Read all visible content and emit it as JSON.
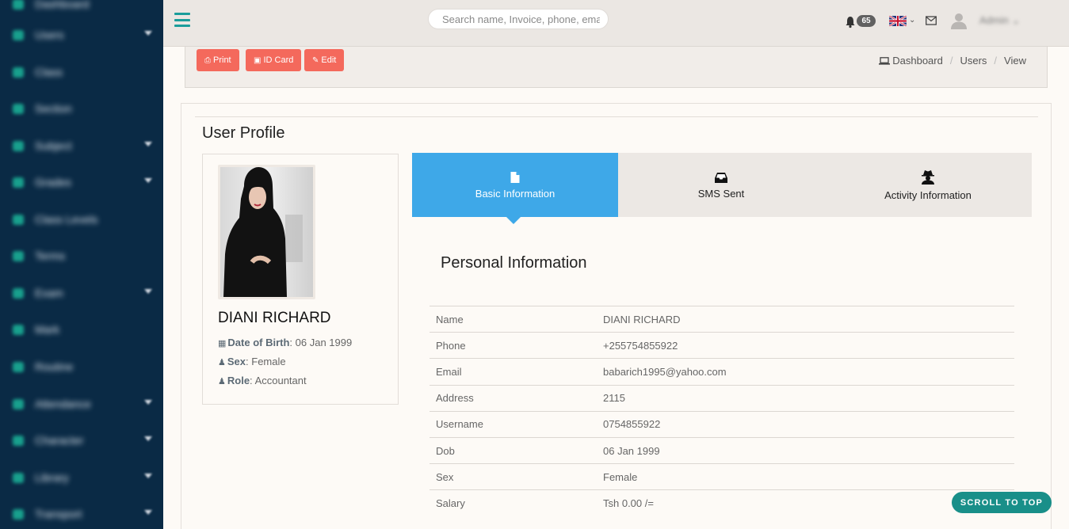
{
  "sidebar": {
    "items": [
      {
        "label": "Dashboard",
        "icon": "dashboard-icon",
        "caret": false
      },
      {
        "label": "Users",
        "icon": "users-icon",
        "caret": true
      },
      {
        "label": "Class",
        "icon": "class-icon",
        "caret": false
      },
      {
        "label": "Section",
        "icon": "section-icon",
        "caret": false
      },
      {
        "label": "Subject",
        "icon": "subject-icon",
        "caret": true
      },
      {
        "label": "Grades",
        "icon": "grades-icon",
        "caret": true
      },
      {
        "label": "Class Levels",
        "icon": "class-levels-icon",
        "caret": false
      },
      {
        "label": "Terms",
        "icon": "terms-icon",
        "caret": false
      },
      {
        "label": "Exam",
        "icon": "exam-icon",
        "caret": true
      },
      {
        "label": "Mark",
        "icon": "mark-icon",
        "caret": false
      },
      {
        "label": "Routine",
        "icon": "routine-icon",
        "caret": false
      },
      {
        "label": "Attendance",
        "icon": "attendance-icon",
        "caret": true
      },
      {
        "label": "Character",
        "icon": "character-icon",
        "caret": true
      },
      {
        "label": "Library",
        "icon": "library-icon",
        "caret": true
      },
      {
        "label": "Transport",
        "icon": "transport-icon",
        "caret": true
      }
    ]
  },
  "topbar": {
    "search_placeholder": "Search name, Invoice, phone, email",
    "notification_count": "65",
    "language_flag": "uk-flag-icon",
    "user_label": "Admin"
  },
  "actions": {
    "print_label": "Print",
    "idcard_label": "ID Card",
    "edit_label": "Edit"
  },
  "breadcrumb": {
    "dashboard": "Dashboard",
    "users": "Users",
    "view": "View"
  },
  "profile": {
    "page_title": "User Profile",
    "name": "DIANI RICHARD",
    "dob_label": "Date of Birth",
    "dob": "06 Jan 1999",
    "sex_label": "Sex",
    "sex": "Female",
    "role_label": "Role",
    "role": "Accountant"
  },
  "tabs": [
    {
      "label": "Basic Information",
      "icon": "file-icon",
      "active": true
    },
    {
      "label": "SMS Sent",
      "icon": "inbox-icon",
      "active": false
    },
    {
      "label": "Activity Information",
      "icon": "user-secret-icon",
      "active": false
    }
  ],
  "personal": {
    "title": "Personal Information",
    "rows": [
      {
        "key": "Name",
        "value": "DIANI RICHARD"
      },
      {
        "key": "Phone",
        "value": "+255754855922"
      },
      {
        "key": "Email",
        "value": "babarich1995@yahoo.com"
      },
      {
        "key": "Address",
        "value": "2115"
      },
      {
        "key": "Username",
        "value": "0754855922"
      },
      {
        "key": "Dob",
        "value": "06 Jan 1999"
      },
      {
        "key": "Sex",
        "value": "Female"
      },
      {
        "key": "Salary",
        "value": "Tsh 0.00 /="
      }
    ]
  },
  "scroll_top_label": "SCROLL TO TOP",
  "colors": {
    "sidebar_bg": "#0a2a45",
    "accent_teal": "#1a9d9b",
    "button_red": "#f4695c",
    "tab_active_blue": "#3ea8e8",
    "scroll_top_bg": "#198f89"
  }
}
